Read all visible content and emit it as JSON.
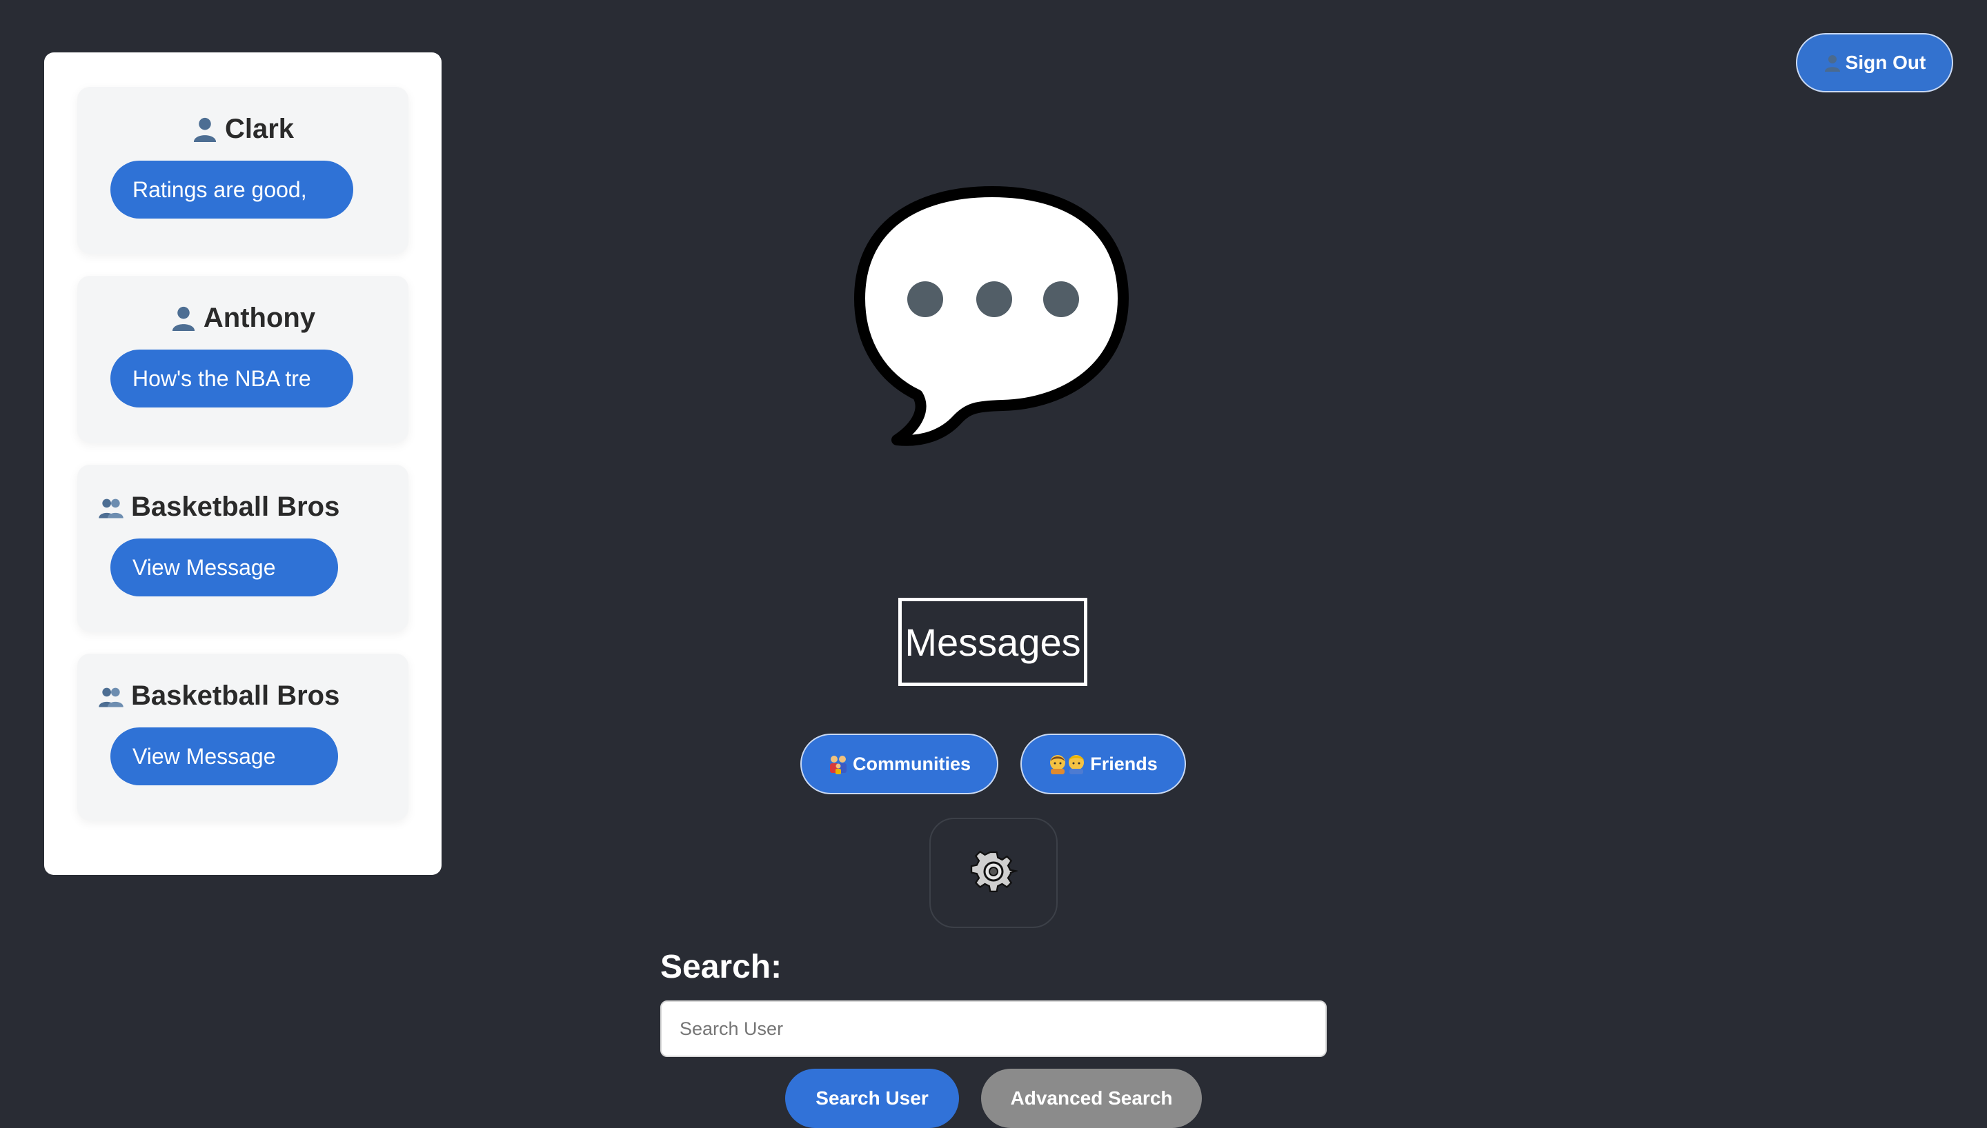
{
  "colors": {
    "background": "#292c34",
    "accent": "#2f72d6",
    "secondary_button": "#8b8b8b",
    "panel": "#ffffff"
  },
  "header": {
    "sign_out_icon": "user-silhouette-icon",
    "sign_out_label": "Sign Out"
  },
  "sidebar": {
    "conversations": [
      {
        "icon": "user-silhouette-icon",
        "name": "Clark",
        "preview": "Ratings are good,"
      },
      {
        "icon": "user-silhouette-icon",
        "name": "Anthony",
        "preview": "How's the NBA tre"
      },
      {
        "icon": "users-silhouette-icon",
        "name": "Basketball Bros",
        "preview": "View Message"
      },
      {
        "icon": "users-silhouette-icon",
        "name": "Basketball Bros",
        "preview": "View Message"
      }
    ]
  },
  "main": {
    "hero_icon": "speech-bubble-ellipsis-icon",
    "title": "Messages",
    "nav": {
      "communities_icon": "family-icon",
      "communities_label": "Communities",
      "friends_icon": "people-icon",
      "friends_label": "Friends"
    },
    "settings_icon": "gear-icon",
    "search": {
      "label": "Search:",
      "placeholder": "Search User",
      "value": "",
      "search_button": "Search User",
      "advanced_button": "Advanced Search"
    }
  }
}
